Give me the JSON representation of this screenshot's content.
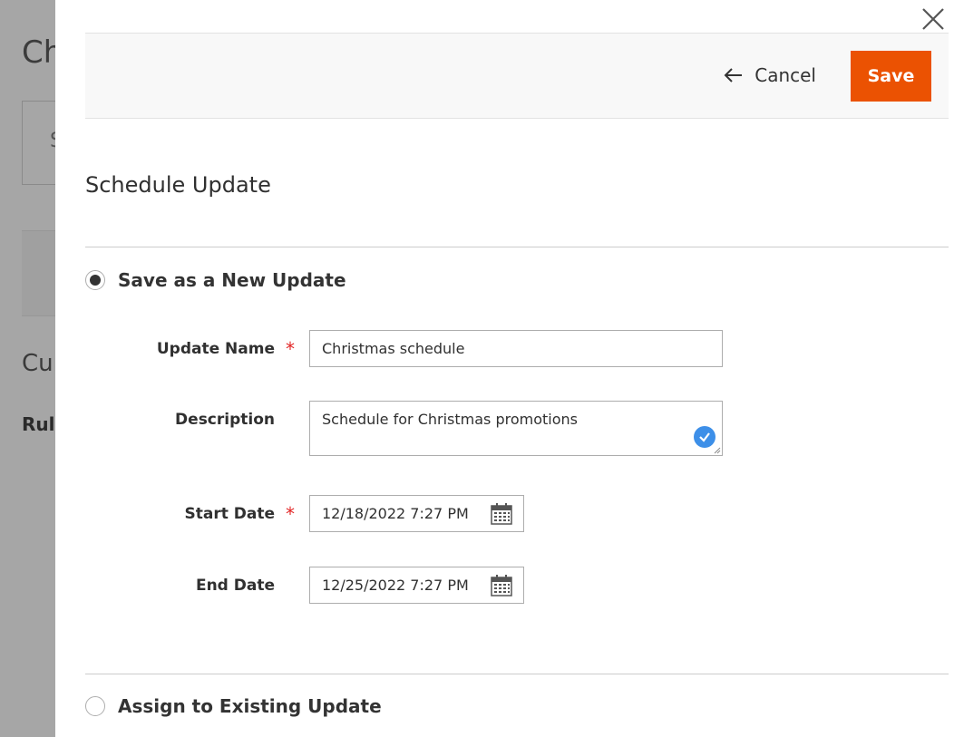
{
  "background": {
    "title": "Ch",
    "box_text": "S",
    "sub_heading": "Cur",
    "rule_label": "Rule"
  },
  "header": {
    "cancel_label": "Cancel",
    "save_label": "Save"
  },
  "section_title": "Schedule Update",
  "options": {
    "new_update": {
      "label": "Save as a New Update",
      "selected": true
    },
    "existing_update": {
      "label": "Assign to Existing Update",
      "selected": false
    }
  },
  "form": {
    "update_name": {
      "label": "Update Name",
      "required_mark": "*",
      "value": "Christmas schedule"
    },
    "description": {
      "label": "Description",
      "value": "Schedule for Christmas promotions"
    },
    "start_date": {
      "label": "Start Date",
      "required_mark": "*",
      "value": "12/18/2022 7:27 PM"
    },
    "end_date": {
      "label": "End Date",
      "value": "12/25/2022 7:27 PM"
    }
  },
  "colors": {
    "accent": "#eb5202",
    "required": "#e22626",
    "check": "#3d8fe8"
  },
  "icons": [
    "close-icon",
    "arrow-left-icon",
    "calendar-icon",
    "check-circle-icon"
  ]
}
